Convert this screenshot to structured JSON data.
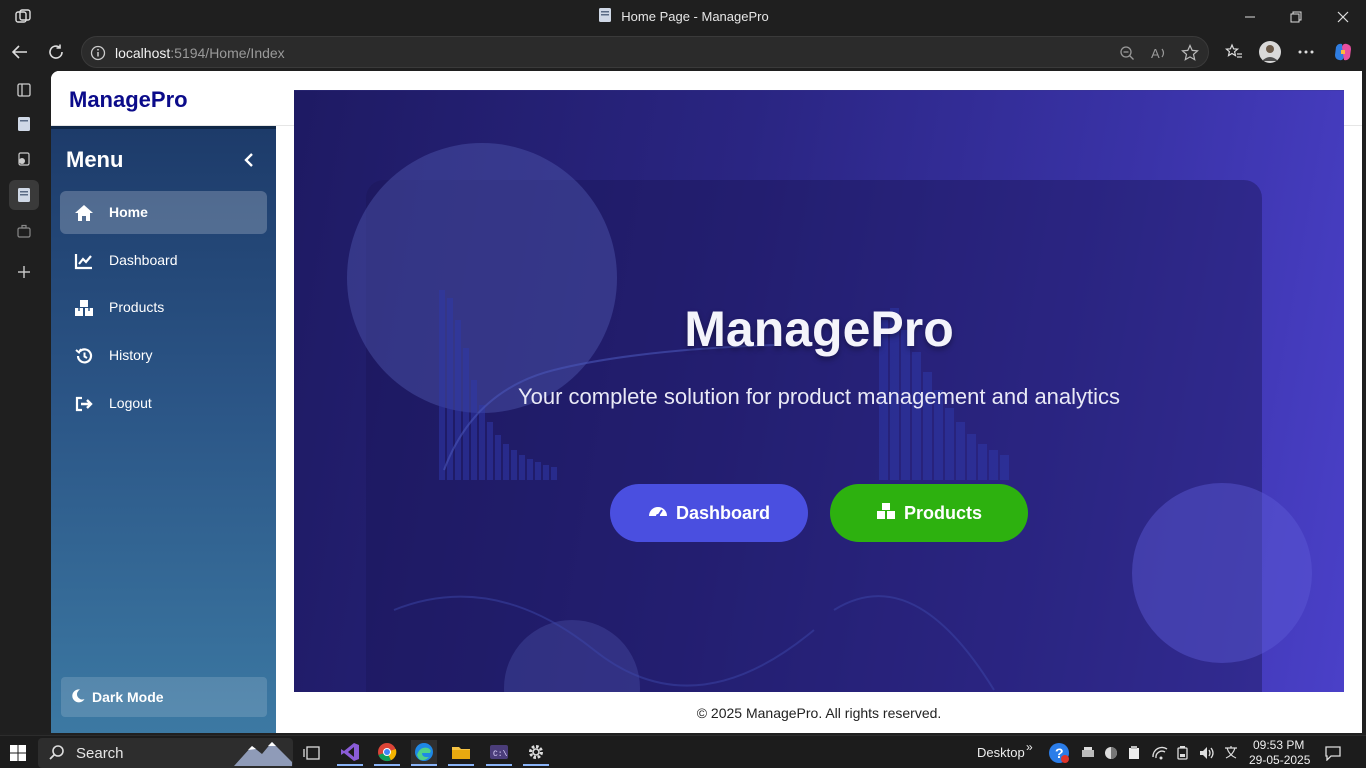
{
  "window": {
    "title": "Home Page - ManagePro",
    "controls": [
      "minimize-icon",
      "restore-icon",
      "close-icon"
    ]
  },
  "browser": {
    "url_host": "localhost",
    "url_rest": ":5194/Home/Index"
  },
  "page": {
    "brand": "ManagePro",
    "sidebar": {
      "title": "Menu",
      "items": [
        {
          "label": "Home",
          "icon": "home-icon",
          "active": true
        },
        {
          "label": "Dashboard",
          "icon": "chart-line-icon",
          "active": false
        },
        {
          "label": "Products",
          "icon": "boxes-icon",
          "active": false
        },
        {
          "label": "History",
          "icon": "history-icon",
          "active": false
        },
        {
          "label": "Logout",
          "icon": "logout-icon",
          "active": false
        }
      ],
      "dark_mode_label": "Dark Mode"
    },
    "hero": {
      "title": "ManagePro",
      "subtitle": "Your complete solution for product management and analytics",
      "dashboard_button": "Dashboard",
      "products_button": "Products"
    },
    "footer": "© 2025 ManagePro. All rights reserved."
  },
  "taskbar": {
    "search_label": "Search",
    "desktop_label": "Desktop",
    "time": "09:53 PM",
    "date": "29-05-2025"
  },
  "colors": {
    "brand_text": "#0b0b8a",
    "dashboard_button": "#4a4fe0",
    "products_button": "#2db10f",
    "hero_bg": "#2a2582"
  }
}
